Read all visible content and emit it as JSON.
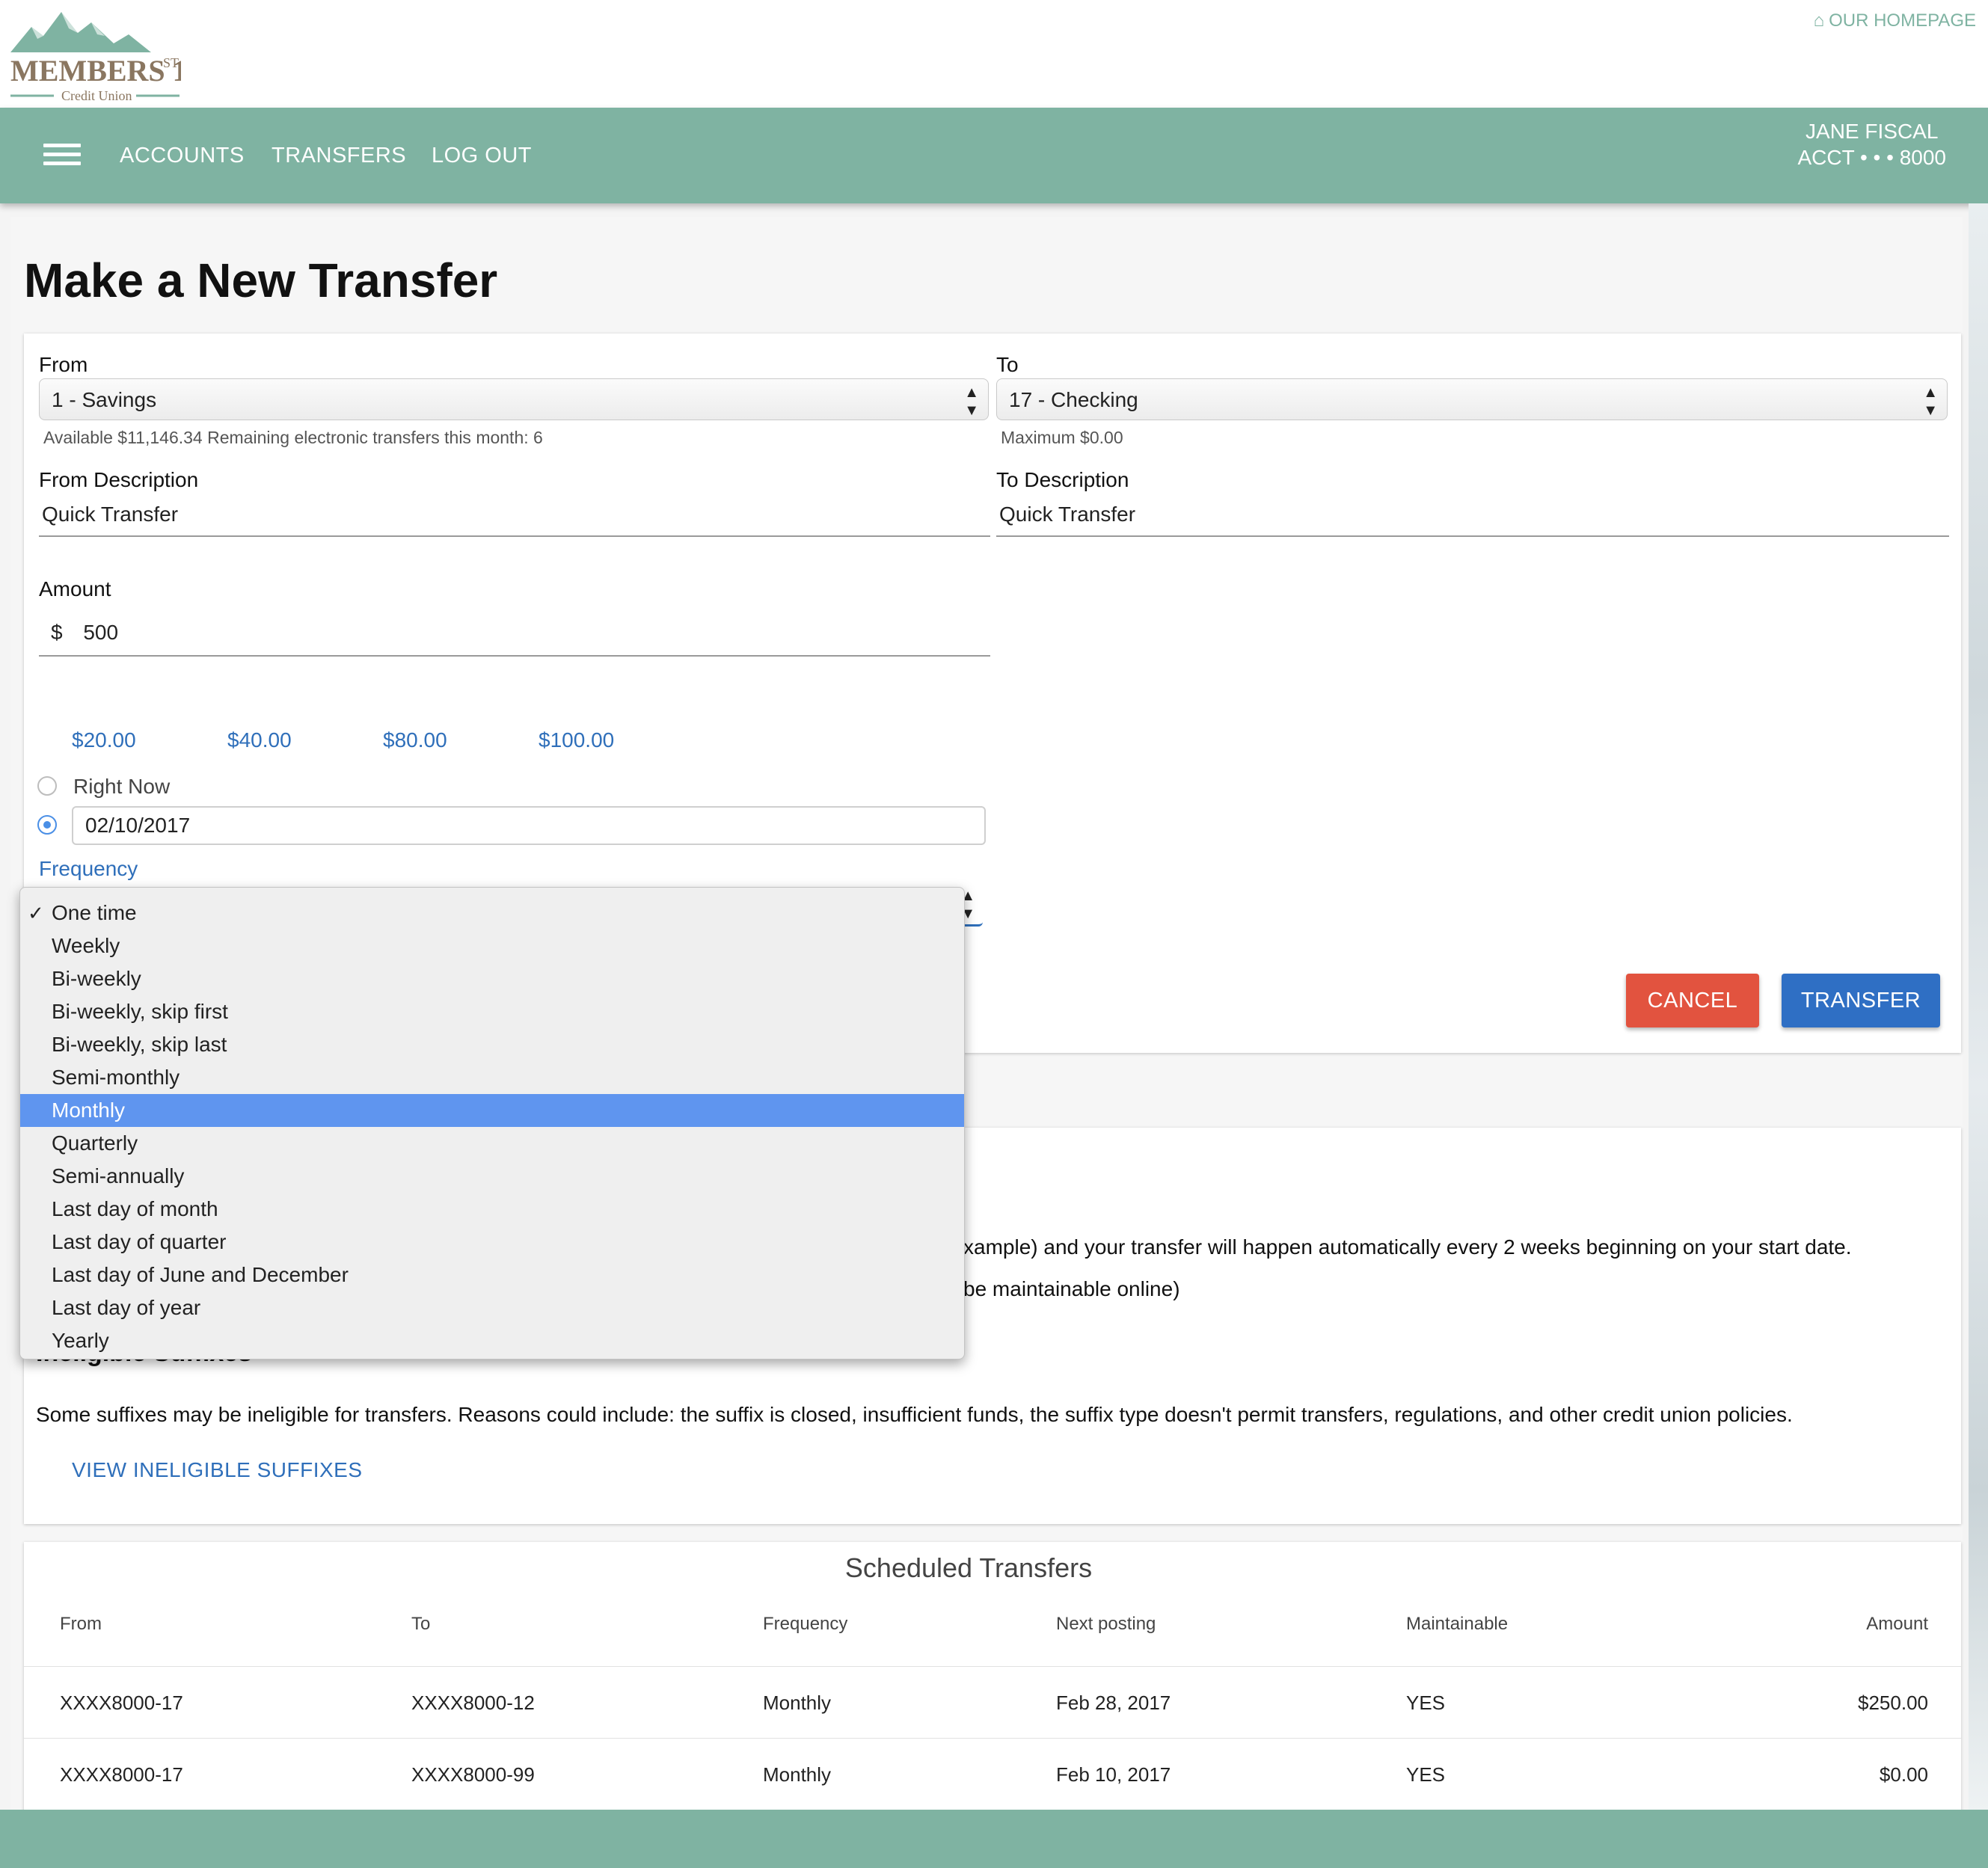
{
  "header": {
    "brand_name": "MEMBERS 1ST",
    "brand_sub": "Credit Union",
    "homepage_link": "OUR HOMEPAGE",
    "icon_home": "home-icon"
  },
  "nav": {
    "icon_menu": "hamburger-menu-icon",
    "links": [
      "ACCOUNTS",
      "TRANSFERS",
      "LOG OUT"
    ],
    "user_name": "JANE FISCAL",
    "user_acct": "ACCT • • • 8000"
  },
  "page": {
    "title": "Make a New Transfer"
  },
  "form": {
    "from_label": "From",
    "from_value": "1 - Savings",
    "from_hint": "Available $11,146.34   Remaining electronic transfers this month: 6",
    "to_label": "To",
    "to_value": "17 - Checking",
    "to_hint": "Maximum $0.00",
    "from_desc_label": "From Description",
    "from_desc_value": "Quick Transfer",
    "to_desc_label": "To Description",
    "to_desc_value": "Quick Transfer",
    "amount_label": "Amount",
    "currency": "$",
    "amount_value": "500",
    "quick_amounts": [
      "$20.00",
      "$40.00",
      "$80.00",
      "$100.00"
    ],
    "right_now_label": "Right Now",
    "date_value": "02/10/2017",
    "frequency_label": "Frequency",
    "cancel_label": "CANCEL",
    "transfer_label": "TRANSFER"
  },
  "frequency_dropdown": {
    "options": [
      "One time",
      "Weekly",
      "Bi-weekly",
      "Bi-weekly, skip first",
      "Bi-weekly, skip last",
      "Semi-monthly",
      "Monthly",
      "Quarterly",
      "Semi-annually",
      "Last day of month",
      "Last day of quarter",
      "Last day of June and December",
      "Last day of year",
      "Yearly"
    ],
    "checked": "One time",
    "highlighted": "Monthly"
  },
  "info": {
    "line1_partial": "xample) and your transfer will happen automatically every 2 weeks beginning on your start date.",
    "line2_partial": "be maintainable online)",
    "ineligible_heading": "Ineligible Suffixes",
    "ineligible_text": "Some suffixes may be ineligible for transfers. Reasons could include: the suffix is closed, insufficient funds, the suffix type doesn't permit transfers, regulations, and other credit union policies.",
    "view_link": "VIEW INELIGIBLE SUFFIXES"
  },
  "scheduled": {
    "title": "Scheduled Transfers",
    "columns": [
      "From",
      "To",
      "Frequency",
      "Next posting",
      "Maintainable",
      "Amount"
    ],
    "rows": [
      [
        "XXXX8000-17",
        "XXXX8000-12",
        "Monthly",
        "Feb 28, 2017",
        "YES",
        "$250.00"
      ],
      [
        "XXXX8000-17",
        "XXXX8000-99",
        "Monthly",
        "Feb 10, 2017",
        "YES",
        "$0.00"
      ]
    ]
  },
  "colors": {
    "brand_green": "#7fb3a2",
    "link_blue": "#2f6fba",
    "cancel_red": "#e2533f",
    "transfer_blue": "#2f6fc4",
    "highlight_blue": "#5f95ef"
  }
}
